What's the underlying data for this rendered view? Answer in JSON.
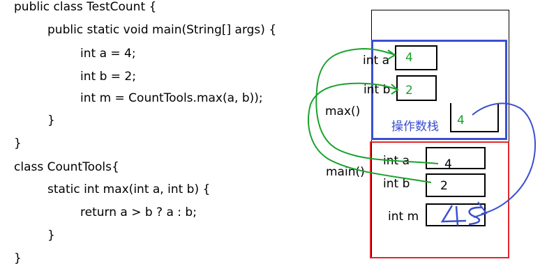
{
  "code": [
    "public class TestCount {",
    "public static void main(String[] args) {",
    "int a = 4;",
    "int b = 2;",
    "int m = CountTools.max(a, b));",
    "}",
    "}",
    "class CountTools{",
    "static int max(int a, int b) {",
    "return a > b ? a : b;",
    "}",
    "}"
  ],
  "max_frame": {
    "label": "max()",
    "var_a_label": "int a",
    "var_a_value": "4",
    "var_b_label": "int b",
    "var_b_value": "2",
    "operand_stack_label": "操作数栈",
    "operand_stack_value": "4"
  },
  "main_frame": {
    "label": "main()",
    "var_a_label": "int a",
    "var_a_value": "4",
    "var_b_label": "int b",
    "var_b_value": "2",
    "var_m_label": "int m",
    "var_m_value": "4"
  },
  "colors": {
    "max_frame_border": "#3a4fd0",
    "main_frame_border": "#e0262b",
    "green_arrow": "#1aa12b",
    "blue_arrow": "#3a4fd0"
  }
}
